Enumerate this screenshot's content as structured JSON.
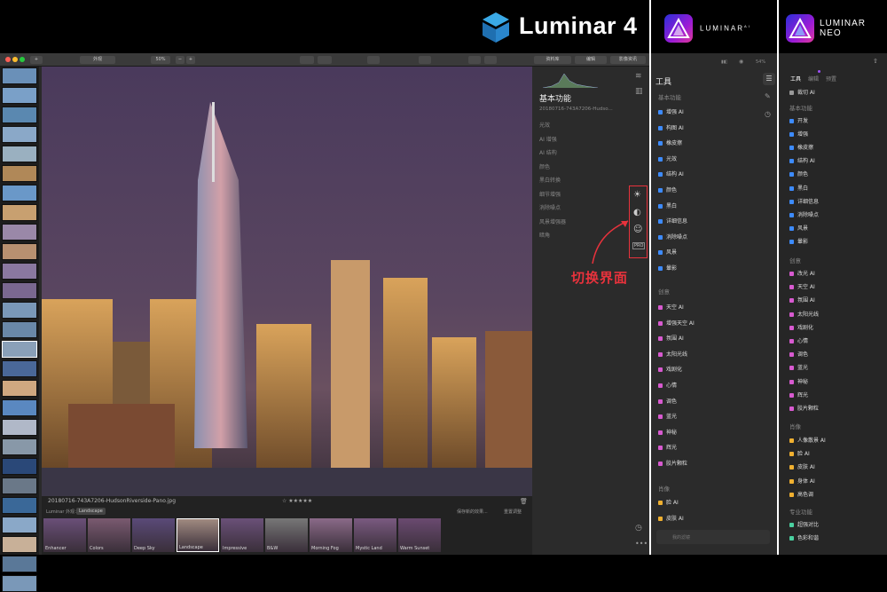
{
  "headers": {
    "l4_title": "Luminar 4",
    "ai_title": "LUMINAR",
    "ai_sup": "AI",
    "neo_title_1": "LUMINAR",
    "neo_title_2": "NEO"
  },
  "l4": {
    "toolbar": {
      "add": "+",
      "view": "外观",
      "zoom": "50%",
      "minus": "−",
      "plus": "+",
      "tab_library": "资料库",
      "tab_edit": "编辑",
      "tab_info": "影像资讯"
    },
    "panel": {
      "title": "基本功能",
      "filename": "20180716-743A7206-Hudso...",
      "items": [
        "光效",
        "AI 增强",
        "AI 结构",
        "颜色",
        "黑白转换",
        "细节增强",
        "消除噪点",
        "风景增强器",
        "暗角"
      ]
    },
    "caption": "切换界面",
    "photo": {
      "filename": "20180716-743A7206-HudsonRiverside-Pano.jpg",
      "rating": "☆ ★★★★★",
      "looks_label": "Luminar 外观：",
      "looks_value": "Landscape",
      "save_btn": "保存新的效果...",
      "reset_btn": "重置调整"
    },
    "looks": [
      "Enhancer",
      "Colors",
      "Deep Sky",
      "Landscape",
      "Impressive",
      "B&W",
      "Morning Fog",
      "Mystic Land",
      "Warm Sunset"
    ]
  },
  "ai": {
    "zoom": "54%",
    "title": "工具",
    "sec_basic": "基本功能",
    "basic": [
      "增强 AI",
      "构图 AI",
      "橡皮擦",
      "光效",
      "结构 AI",
      "颜色",
      "黑白",
      "详细信息",
      "消除噪点",
      "风景",
      "暈影"
    ],
    "sec_creative": "创意",
    "creative": [
      "天空 AI",
      "增强天空 AI",
      "氛围 AI",
      "太阳光线",
      "戏剧化",
      "心情",
      "调色",
      "蓝光",
      "神秘",
      "辉光",
      "胶片颗粒"
    ],
    "sec_portrait": "肖像",
    "portrait": [
      "脸 AI",
      "皮肤 AI"
    ],
    "footer": "我的滤镜"
  },
  "neo": {
    "tabs": [
      "工具",
      "编辑",
      "预置"
    ],
    "crop": "裁切 AI",
    "sec_basic": "基本功能",
    "basic": [
      "开发",
      "增强",
      "橡皮擦",
      "结构 AI",
      "颜色",
      "黑白",
      "详细信息",
      "消除噪点",
      "风景",
      "暈影"
    ],
    "sec_creative": "创意",
    "creative": [
      "改光 AI",
      "天空 AI",
      "氛围 AI",
      "太阳光线",
      "戏剧化",
      "心情",
      "调色",
      "蓝光",
      "神秘",
      "辉光",
      "胶片颗粒"
    ],
    "sec_portrait": "肖像",
    "portrait": [
      "人像散景 AI",
      "脸 AI",
      "皮肤 AI",
      "身体 AI",
      "高色调"
    ],
    "sec_pro": "专业功能",
    "pro": [
      "超强对比",
      "色彩和谐"
    ]
  },
  "colors": {
    "accent": "#3d8bff",
    "red_label": "#e8323c",
    "panel": "#2b2b2b"
  }
}
